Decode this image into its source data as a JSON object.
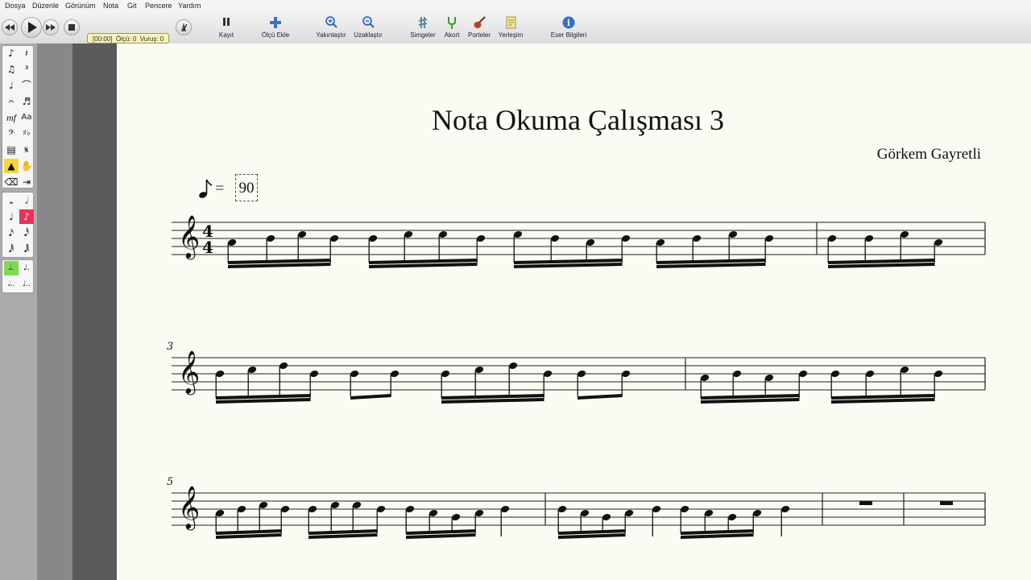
{
  "menu": [
    "Dosya",
    "Düzenle",
    "Görünüm",
    "Nota",
    "Git",
    "Pencere",
    "Yardım"
  ],
  "transport": {
    "rewind": "rewind",
    "play": "play",
    "fastforward": "fast-forward",
    "stop": "stop",
    "metronome": "metronome"
  },
  "status": {
    "time": "[00:00]",
    "measure": "Ölçü: 0",
    "beat": "Vuruş: 0"
  },
  "toolbar": [
    {
      "id": "record",
      "label": "Kayıt",
      "icon": "pause-icon"
    },
    {
      "id": "add-measure",
      "label": "Ölçü Ekle",
      "icon": "plus-icon"
    },
    {
      "id": "zoom-in",
      "label": "Yakınlaştır",
      "icon": "zoom-in-icon"
    },
    {
      "id": "zoom-out",
      "label": "Uzaklaştır",
      "icon": "zoom-out-icon"
    },
    {
      "id": "symbols",
      "label": "Simgeler",
      "icon": "sharp-icon"
    },
    {
      "id": "chord",
      "label": "Akort",
      "icon": "tuning-fork-icon"
    },
    {
      "id": "instruments",
      "label": "Porteler",
      "icon": "violin-icon"
    },
    {
      "id": "layout",
      "label": "Yerleşim",
      "icon": "layout-icon"
    },
    {
      "id": "info",
      "label": "Eser Bilgileri",
      "icon": "info-icon"
    }
  ],
  "palette": {
    "group1": [
      "♪",
      "𝄽",
      "♫",
      "³",
      "♩",
      "⌒",
      "𝄐",
      "♬",
      "mf",
      "Aa",
      "𝄢",
      "♯♭",
      "▤",
      "𝄋",
      "▲",
      "✋",
      "⌫",
      "⇥"
    ],
    "group2": [
      "𝅝",
      "𝅗𝅥",
      "♩",
      "♪",
      "𝅘𝅥𝅯",
      "𝅘𝅥𝅰",
      "𝅘𝅥𝅱",
      "𝅘𝅥𝅲"
    ],
    "group3": [
      "𝅗𝅥.",
      "♩.",
      "𝅗𝅥..",
      "♩.."
    ]
  },
  "score": {
    "title": "Nota Okuma Çalışması 3",
    "composer": "Görkem Gayretli",
    "tempo": {
      "equals": "=",
      "value": "90"
    },
    "time_signature": {
      "top": "4",
      "bottom": "4"
    },
    "measure_numbers": [
      "3",
      "5"
    ]
  },
  "colors": {
    "paper": "#fbfbf4",
    "selected_duration": "#e8345c",
    "selected_dot": "#7ed957",
    "status_bg": "#f7f3b9"
  }
}
